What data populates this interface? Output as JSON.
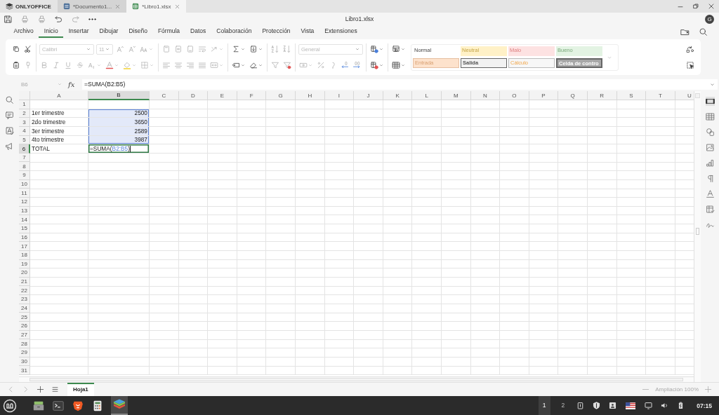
{
  "app_tabs": [
    {
      "label": "ONLYOFFICE",
      "kind": "home",
      "selected": false
    },
    {
      "label": "*Documento1...",
      "kind": "document",
      "selected": false
    },
    {
      "label": "*Libro1.xlsx",
      "kind": "spreadsheet",
      "selected": true
    }
  ],
  "window": {
    "title": "Libro1.xlsx",
    "avatar": "G"
  },
  "menu": [
    {
      "label": "Archivo",
      "selected": false
    },
    {
      "label": "Inicio",
      "selected": true
    },
    {
      "label": "Insertar",
      "selected": false
    },
    {
      "label": "Dibujar",
      "selected": false
    },
    {
      "label": "Diseño",
      "selected": false
    },
    {
      "label": "Fórmula",
      "selected": false
    },
    {
      "label": "Datos",
      "selected": false
    },
    {
      "label": "Colaboración",
      "selected": false
    },
    {
      "label": "Protección",
      "selected": false
    },
    {
      "label": "Vista",
      "selected": false
    },
    {
      "label": "Extensiones",
      "selected": false
    }
  ],
  "ribbon": {
    "font": "Calibri",
    "size": "11",
    "number_format": "General",
    "formatting_disabled": true,
    "styles": [
      {
        "label": "Normal",
        "kind": "normal"
      },
      {
        "label": "Neutral",
        "kind": "neutral"
      },
      {
        "label": "Malo",
        "kind": "bad"
      },
      {
        "label": "Bueno",
        "kind": "good"
      },
      {
        "label": "Entrada",
        "kind": "input"
      },
      {
        "label": "Salida",
        "kind": "output"
      },
      {
        "label": "Cálculo",
        "kind": "calculation"
      },
      {
        "label": "Celda de contro",
        "kind": "check"
      }
    ]
  },
  "formula_bar": {
    "cell": "B6",
    "function_label": "fx",
    "formula": "=SUMA(B2:B5)"
  },
  "sheet": {
    "columns": [
      {
        "label": "A",
        "selected": false
      },
      {
        "label": "B",
        "selected": true
      },
      {
        "label": "C",
        "selected": false
      },
      {
        "label": "D",
        "selected": false
      },
      {
        "label": "E",
        "selected": false
      },
      {
        "label": "F",
        "selected": false
      },
      {
        "label": "G",
        "selected": false
      },
      {
        "label": "H",
        "selected": false
      },
      {
        "label": "I",
        "selected": false
      },
      {
        "label": "J",
        "selected": false
      },
      {
        "label": "K",
        "selected": false
      },
      {
        "label": "L",
        "selected": false
      },
      {
        "label": "M",
        "selected": false
      },
      {
        "label": "N",
        "selected": false
      },
      {
        "label": "O",
        "selected": false
      },
      {
        "label": "P",
        "selected": false
      },
      {
        "label": "Q",
        "selected": false
      },
      {
        "label": "R",
        "selected": false
      },
      {
        "label": "S",
        "selected": false
      },
      {
        "label": "T",
        "selected": false
      },
      {
        "label": "U",
        "selected": false
      }
    ],
    "rows": [
      {
        "label": "1",
        "selected": false
      },
      {
        "label": "2",
        "selected": false,
        "cells": [
          {
            "text": "1er trimestre",
            "kind": "text",
            "selected": false
          },
          {
            "text": "2500",
            "kind": "number",
            "selected": true
          }
        ]
      },
      {
        "label": "3",
        "selected": false,
        "cells": [
          {
            "text": "2do trimestre",
            "kind": "text",
            "selected": false
          },
          {
            "text": "3650",
            "kind": "number",
            "selected": true
          }
        ]
      },
      {
        "label": "4",
        "selected": false,
        "cells": [
          {
            "text": "3er trimestre",
            "kind": "text",
            "selected": false
          },
          {
            "text": "2589",
            "kind": "number",
            "selected": true
          }
        ]
      },
      {
        "label": "5",
        "selected": false,
        "cells": [
          {
            "text": "4to trimestre",
            "kind": "text",
            "selected": false
          },
          {
            "text": "3987",
            "kind": "number",
            "selected": true
          }
        ]
      },
      {
        "label": "6",
        "selected": true,
        "cells": [
          {
            "text": "TOTAL",
            "kind": "text",
            "selected": false
          },
          {
            "kind": "formula",
            "function": "=SUMA(",
            "reference": "B2:B5",
            "close": ")",
            "selected": false,
            "active": true
          }
        ]
      },
      {
        "label": "7",
        "selected": false
      },
      {
        "label": "8",
        "selected": false
      },
      {
        "label": "9",
        "selected": false
      },
      {
        "label": "10",
        "selected": false
      },
      {
        "label": "11",
        "selected": false
      },
      {
        "label": "12",
        "selected": false
      },
      {
        "label": "13",
        "selected": false
      },
      {
        "label": "14",
        "selected": false
      },
      {
        "label": "15",
        "selected": false
      },
      {
        "label": "16",
        "selected": false
      },
      {
        "label": "17",
        "selected": false
      },
      {
        "label": "18",
        "selected": false
      },
      {
        "label": "19",
        "selected": false
      },
      {
        "label": "20",
        "selected": false
      },
      {
        "label": "21",
        "selected": false
      },
      {
        "label": "22",
        "selected": false
      },
      {
        "label": "23",
        "selected": false
      },
      {
        "label": "24",
        "selected": false
      },
      {
        "label": "25",
        "selected": false
      },
      {
        "label": "26",
        "selected": false
      },
      {
        "label": "27",
        "selected": false
      },
      {
        "label": "28",
        "selected": false
      },
      {
        "label": "29",
        "selected": false
      },
      {
        "label": "30",
        "selected": false
      },
      {
        "label": "31",
        "selected": false
      }
    ]
  },
  "sheet_tabs": [
    {
      "label": "Hoja1",
      "selected": true
    }
  ],
  "zoom": {
    "label": "Ampliación 100%"
  },
  "taskbar": {
    "workspaces": [
      {
        "label": "1",
        "selected": true
      },
      {
        "label": "2",
        "selected": false
      }
    ],
    "time": "07:15"
  }
}
